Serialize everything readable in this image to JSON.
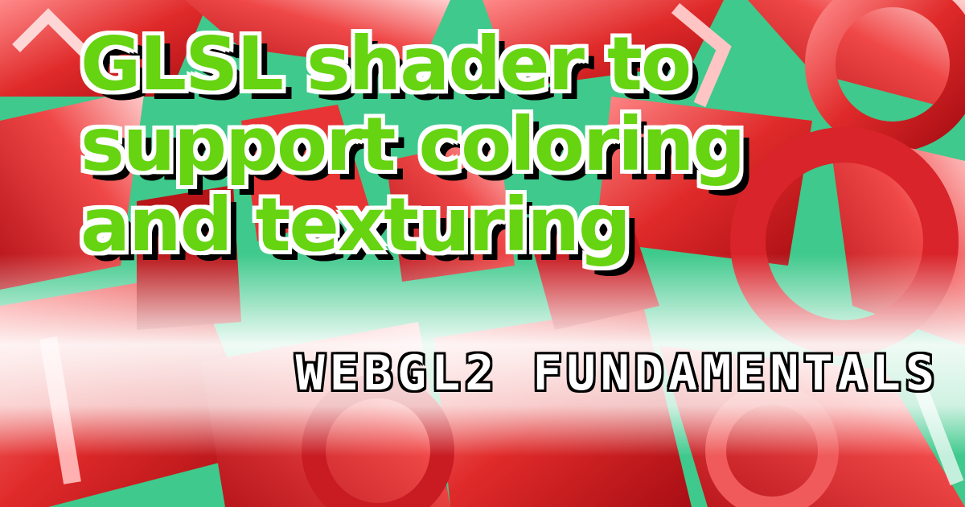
{
  "hero": {
    "title_lines": [
      "GLSL shader to",
      "support coloring",
      "and texturing"
    ],
    "brand": "WEBGL2  FUNDAMENTALS"
  },
  "colors": {
    "background_green": "#3fc98c",
    "letter_red": "#e02a2a",
    "title_green": "#66d411",
    "title_outline": "#ffffff",
    "title_shadow": "#000000",
    "brand_text": "#ffffff",
    "brand_outline": "#000000"
  },
  "icons": [
    "scattered-3d-letters-background"
  ]
}
